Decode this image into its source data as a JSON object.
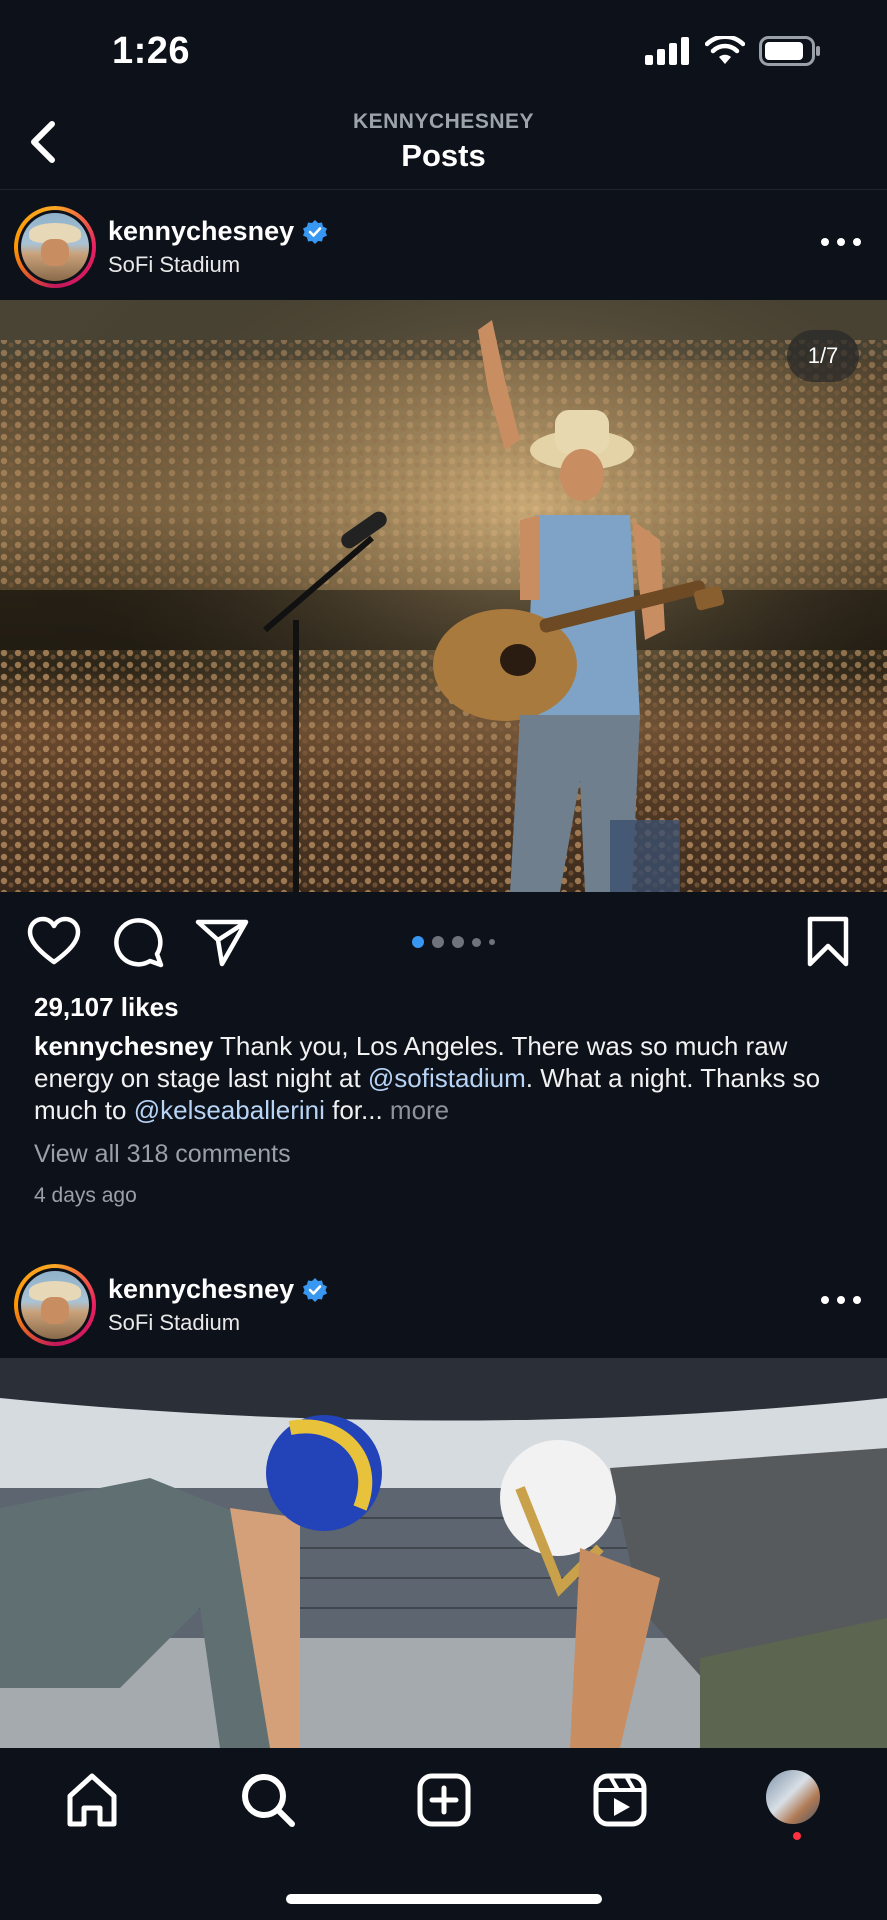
{
  "status_bar": {
    "time": "1:26"
  },
  "header": {
    "subtitle": "KENNYCHESNEY",
    "title": "Posts"
  },
  "posts": [
    {
      "username": "kennychesney",
      "location": "SoFi Stadium",
      "verified": true,
      "counter": "1/7",
      "carousel_total": 7,
      "carousel_index": 1,
      "likes": "29,107 likes",
      "caption": {
        "user": "kennychesney",
        "text1": " Thank you, Los Angeles. There was so much raw energy on stage last night at ",
        "mention1": "@sofistadium",
        "text2": ". What a night. Thanks so much to ",
        "mention2": "@kelseaballerini",
        "text3": " for... ",
        "more": "more"
      },
      "view_comments": "View all 318 comments",
      "time_ago": "4 days ago"
    },
    {
      "username": "kennychesney",
      "location": "SoFi Stadium",
      "verified": true
    }
  ],
  "colors": {
    "background": "#0d1119",
    "verified_badge": "#3897f0",
    "mention": "#b7d3f5",
    "active_dot": "#3897f0",
    "notification_dot": "#ff3040"
  },
  "icons": {
    "back": "chevron-left-icon",
    "like": "heart-icon",
    "comment": "comment-bubble-icon",
    "share": "paper-plane-icon",
    "save": "bookmark-icon",
    "more": "ellipsis-icon",
    "tabs": [
      "home-icon",
      "search-icon",
      "add-post-icon",
      "reels-icon",
      "profile-avatar"
    ]
  }
}
